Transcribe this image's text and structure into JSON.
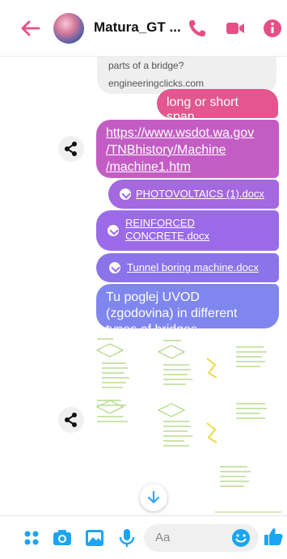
{
  "header": {
    "title": "Matura_GT ...",
    "accent": "#e64f86"
  },
  "messages": {
    "incoming_question": "parts of a bridge?",
    "incoming_source": "engineeringclicks.com",
    "m1": "long or short span",
    "m2_link": "https://www.wsdot.wa.gov/TNBhistory/Machine/machine1.htm",
    "m2_line1": "https://www.wsdot.wa.gov",
    "m2_line2": "/TNBhistory/Machine",
    "m2_line3": "/machine1.htm",
    "file1": "PHOTOVOLTAICS (1).docx",
    "file2_line1": "REINFORCED",
    "file2_line2": "CONCRETE.docx",
    "file3": "Tunnel boring machine.docx",
    "m6": "Tu poglej UVOD (zgodovina) in different types of bridges"
  },
  "composer": {
    "placeholder": "Aa"
  },
  "icons": {
    "back": "back-arrow-icon",
    "call": "phone-icon",
    "video": "video-icon",
    "info": "info-icon",
    "share": "share-icon",
    "download": "download-icon",
    "apps": "apps-grid-icon",
    "camera": "camera-icon",
    "gallery": "image-icon",
    "mic": "microphone-icon",
    "emoji": "emoji-icon",
    "like": "thumbs-up-icon",
    "scroll": "scroll-down-icon"
  }
}
